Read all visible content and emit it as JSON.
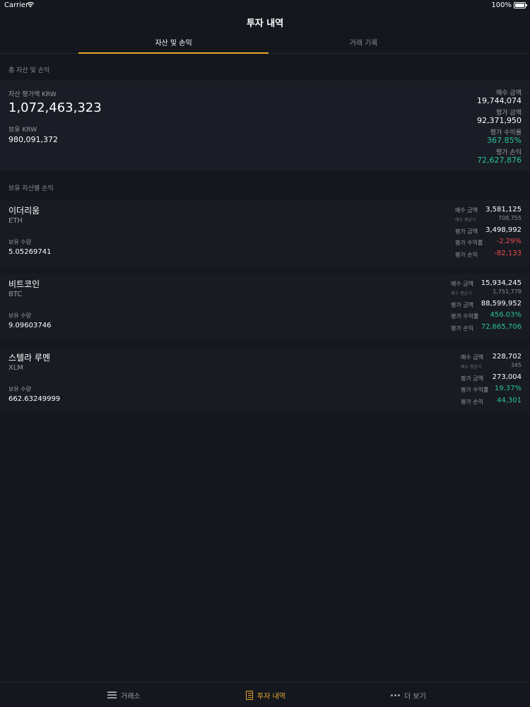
{
  "status_bar": {
    "carrier": "Carrier",
    "battery": "100%"
  },
  "nav": {
    "title": "투자 내역"
  },
  "tabs": [
    {
      "label": "자산 및 손익",
      "active": true
    },
    {
      "label": "거래 기록",
      "active": false
    }
  ],
  "summary": {
    "section_title": "총 자산 및 손익",
    "total_label": "자산 평가액 KRW",
    "total_value": "1,072,463,323",
    "held_label": "보유 KRW",
    "held_value": "980,091,372",
    "buy_label": "매수 금액",
    "buy_value": "19,744,074",
    "eval_label": "평가 금액",
    "eval_value": "92,371,950",
    "rate_label": "평가 수익률",
    "rate_value": "367.85%",
    "pnl_label": "평가 손익",
    "pnl_value": "72,627,876"
  },
  "holdings": {
    "section_title": "보유 자산별 손익",
    "labels": {
      "quantity": "보유 수량",
      "buy_amount": "매수 금액",
      "avg_price": "매수 평균가",
      "eval_amount": "평가 금액",
      "eval_rate": "평가 수익률",
      "eval_pnl": "평가 손익"
    },
    "items": [
      {
        "name": "이더리움",
        "ticker": "ETH",
        "quantity": "5.05269741",
        "buy_amount": "3,581,125",
        "avg_price": "708,755",
        "eval_amount": "3,498,992",
        "eval_rate": "-2.29%",
        "eval_pnl": "-82,133"
      },
      {
        "name": "비트코인",
        "ticker": "BTC",
        "quantity": "9.09603746",
        "buy_amount": "15,934,245",
        "avg_price": "1,751,778",
        "eval_amount": "88,599,952",
        "eval_rate": "456.03%",
        "eval_pnl": "72,665,706"
      },
      {
        "name": "스텔라 루멘",
        "ticker": "XLM",
        "quantity": "662.63249999",
        "buy_amount": "228,702",
        "avg_price": "345",
        "eval_amount": "273,004",
        "eval_rate": "19.37%",
        "eval_pnl": "44,301"
      }
    ]
  },
  "bottom_nav": [
    {
      "label": "거래소",
      "icon": "menu-icon"
    },
    {
      "label": "투자 내역",
      "icon": "document-icon",
      "active": true
    },
    {
      "label": "더 보기",
      "icon": "more-dots-icon"
    }
  ],
  "colors": {
    "accent": "#e6a92e",
    "positive": "#29c39b",
    "negative": "#ef4c4c",
    "background": "#15171e"
  }
}
